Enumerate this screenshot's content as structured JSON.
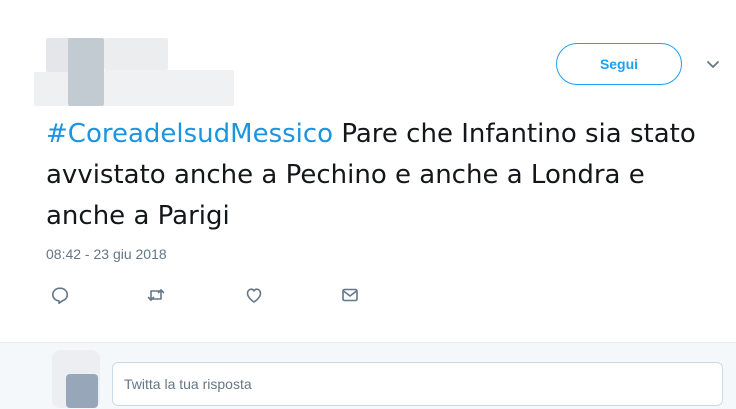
{
  "header": {
    "follow_label": "Segui",
    "menu_icon": "chevron-down-icon"
  },
  "tweet": {
    "hashtag": "#CoreadelsudMessico",
    "text": " Pare che Infantino sia stato avvistato anche a Pechino e anche a Londra e anche a Parigi",
    "timestamp": "08:42 - 23 giu 2018"
  },
  "actions": [
    {
      "name": "reply",
      "icon": "reply-icon"
    },
    {
      "name": "retweet",
      "icon": "retweet-icon"
    },
    {
      "name": "like",
      "icon": "heart-icon"
    },
    {
      "name": "message",
      "icon": "envelope-icon"
    }
  ],
  "reply": {
    "placeholder": "Twitta la tua risposta"
  },
  "colors": {
    "accent": "#1da1f2",
    "hashtag": "#1b95e0",
    "muted": "#657786",
    "reply_bar_bg": "#f5f8fa"
  }
}
